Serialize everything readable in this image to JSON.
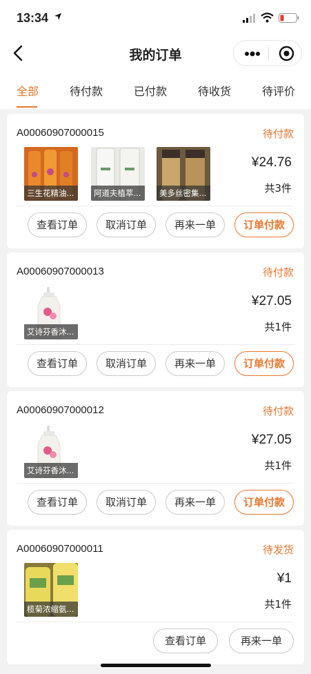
{
  "status_bar": {
    "time": "13:34"
  },
  "nav": {
    "title": "我的订单"
  },
  "tabs": [
    {
      "label": "全部",
      "active": true
    },
    {
      "label": "待付款",
      "active": false
    },
    {
      "label": "已付款",
      "active": false
    },
    {
      "label": "待收货",
      "active": false
    },
    {
      "label": "待评价",
      "active": false
    }
  ],
  "colors": {
    "accent": "#e8772e",
    "background": "#f2f2f2"
  },
  "orders": [
    {
      "order_no": "A00060907000015",
      "status": "待付款",
      "products": [
        {
          "label": "三生花精油...",
          "image": "orange-bottles"
        },
        {
          "label": "阿道夫植萃...",
          "image": "white-bottles"
        },
        {
          "label": "美多丝密集...",
          "image": "gold-bottles"
        }
      ],
      "price": "¥24.76",
      "count": "共3件",
      "buttons": [
        "查看订单",
        "取消订单",
        "再来一单",
        "订单付款"
      ]
    },
    {
      "order_no": "A00060907000013",
      "status": "待付款",
      "products": [
        {
          "label": "艾诗芬香沐...",
          "image": "pump-bottle"
        }
      ],
      "price": "¥27.05",
      "count": "共1件",
      "buttons": [
        "查看订单",
        "取消订单",
        "再来一单",
        "订单付款"
      ]
    },
    {
      "order_no": "A00060907000012",
      "status": "待付款",
      "products": [
        {
          "label": "艾诗芬香沐...",
          "image": "pump-bottle"
        }
      ],
      "price": "¥27.05",
      "count": "共1件",
      "buttons": [
        "查看订单",
        "取消订单",
        "再来一单",
        "订单付款"
      ]
    },
    {
      "order_no": "A00060907000011",
      "status": "待发货",
      "products": [
        {
          "label": "榄菊浓缩氨...",
          "image": "yellow-bottles"
        }
      ],
      "price": "¥1",
      "count": "共1件",
      "buttons": [
        "查看订单",
        "再来一单"
      ]
    }
  ]
}
